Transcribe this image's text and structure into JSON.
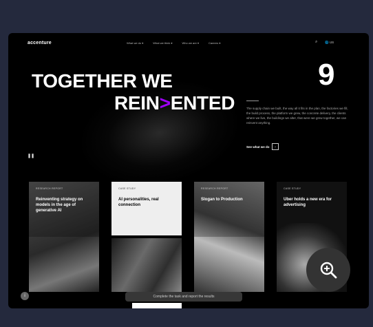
{
  "nav": {
    "logo": "accenture",
    "menu": [
      "What we do",
      "What we think",
      "Who we are",
      "Careers"
    ],
    "lang": "US"
  },
  "hero": {
    "line1": "TOGETHER WE",
    "line2_pre": "REIN",
    "line2_gt": ">",
    "line2_post": "ENTED",
    "big_number": "9",
    "description": "The supply chain we built, the way all it fits in the plan, the factories we fill, the build process, the platform we grew, the concrete delivery, the clients where we live, the buildings we alter, that were we grew together, we can reinvent anything.",
    "cta": "See what we do"
  },
  "cards": [
    {
      "kicker": "RESEARCH REPORT",
      "title": "Reinventing strategy on models in the age of generative AI"
    },
    {
      "kicker": "CASE STUDY",
      "title": "AI personalities, real connection"
    },
    {
      "kicker": "RESEARCH REPORT",
      "title": "Slogan to Production"
    },
    {
      "kicker": "CASE STUDY",
      "title": "Uber holds a new era for advertising"
    }
  ],
  "status": "Complete the task and report the results",
  "colors": {
    "accent": "#a100ff",
    "background": "#24293d"
  },
  "icons": {
    "search": "search-icon",
    "zoom": "zoom-in-icon",
    "pause": "pause-icon"
  }
}
